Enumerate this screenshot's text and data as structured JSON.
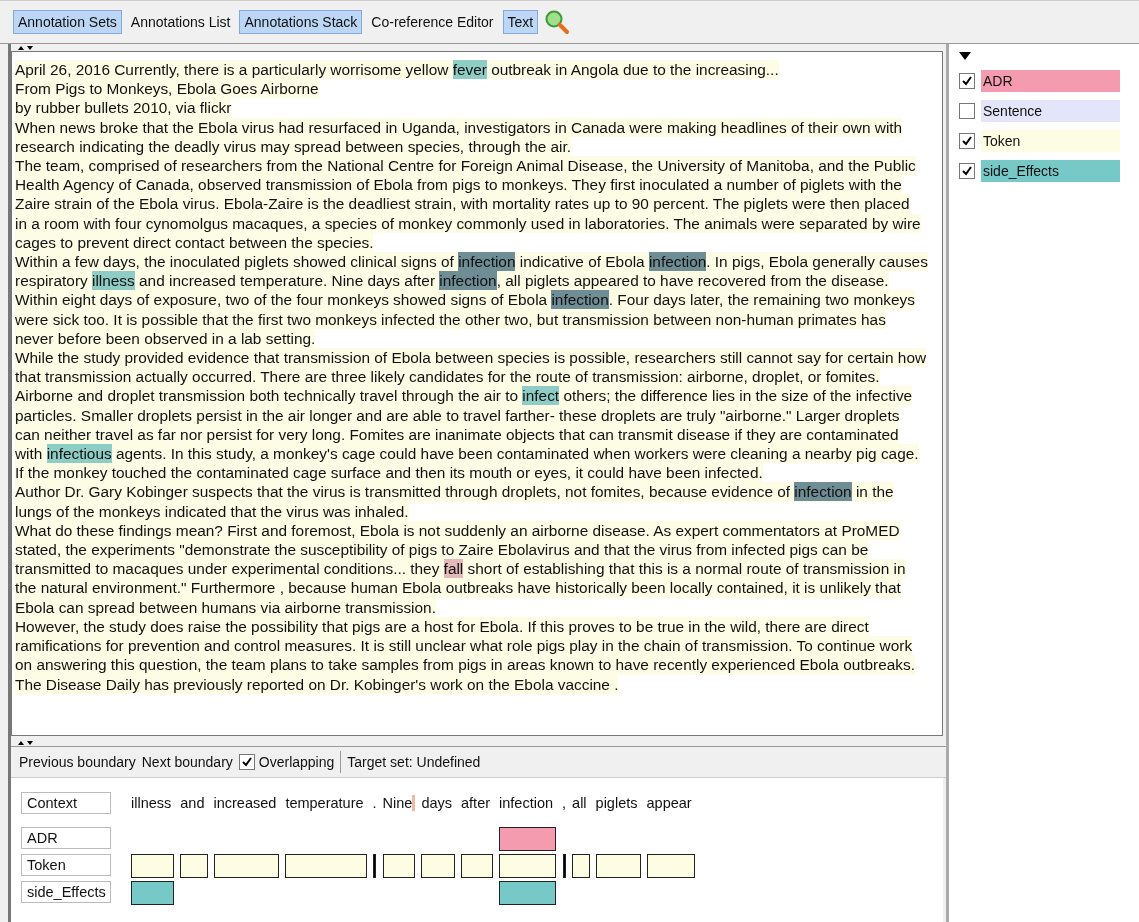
{
  "tabs": [
    {
      "label": "Annotation Sets",
      "selected": true
    },
    {
      "label": "Annotations List",
      "selected": false
    },
    {
      "label": "Annotations Stack",
      "selected": true
    },
    {
      "label": "Co-reference Editor",
      "selected": false
    },
    {
      "label": "Text",
      "selected": true
    }
  ],
  "document": {
    "lines": [
      [
        {
          "text": "April 26, 2016 Currently, there is a particularly worrisome yellow "
        },
        {
          "text": "fever",
          "color": "#8ecdc5"
        },
        {
          "text": " outbreak in Angola due to the increasing..."
        }
      ],
      [
        {
          "text": "From Pigs to Monkeys, Ebola Goes Airborne"
        }
      ],
      [
        {
          "text": "by rubber bullets 2010, via flickr"
        }
      ],
      [
        {
          "text": "When news broke that the Ebola virus had resurfaced in Uganda, investigators in Canada were making headlines of their own with"
        }
      ],
      [
        {
          "text": "research indicating the deadly virus may spread between species, through the air."
        }
      ],
      [
        {
          "text": "The team, comprised of researchers from the National Centre for Foreign Animal Disease, the University of Manitoba, and the Public"
        }
      ],
      [
        {
          "text": "Health Agency of Canada, observed transmission of Ebola from pigs to monkeys. They first inoculated a number of piglets with the"
        }
      ],
      [
        {
          "text": "Zaire strain of the Ebola virus. Ebola-Zaire is the deadliest strain, with mortality rates up to 90 percent. The piglets were then placed"
        }
      ],
      [
        {
          "text": "in a room with four cynomolgus macaques, a species of monkey commonly used in laboratories. The animals were separated by wire"
        }
      ],
      [
        {
          "text": "cages to prevent direct contact between the species."
        }
      ],
      [
        {
          "text": "Within a few days, the inoculated piglets showed clinical signs of "
        },
        {
          "text": "infection",
          "color": "#6f8d95"
        },
        {
          "text": " indicative of Ebola "
        },
        {
          "text": "infection",
          "color": "#6f8d95"
        },
        {
          "text": ". In pigs, Ebola generally causes"
        }
      ],
      [
        {
          "text": "respiratory "
        },
        {
          "text": "illness",
          "color": "#8ecdc5"
        },
        {
          "text": " and increased temperature. Nine days after "
        },
        {
          "text": "infection",
          "color": "#6f8d95"
        },
        {
          "text": ", all piglets appeared to have recovered from the disease."
        }
      ],
      [
        {
          "text": "Within eight days of exposure, two of the four monkeys showed signs of Ebola "
        },
        {
          "text": "infection",
          "color": "#6f8d95"
        },
        {
          "text": ". Four days later, the remaining two monkeys"
        }
      ],
      [
        {
          "text": "were sick too. It is possible that the first two monkeys infected the other two, but transmission between non-human primates has"
        }
      ],
      [
        {
          "text": "never before been observed in a lab setting."
        }
      ],
      [
        {
          "text": "While the study provided evidence that transmission of Ebola between species is possible, researchers still cannot say for certain how"
        }
      ],
      [
        {
          "text": "that transmission actually occurred. There are three likely candidates for the route of transmission: airborne, droplet, or fomites."
        }
      ],
      [
        {
          "text": "Airborne and droplet transmission both technically travel through the air to "
        },
        {
          "text": "infect",
          "color": "#8ecdc5"
        },
        {
          "text": " others; the difference lies in the size of the infective"
        }
      ],
      [
        {
          "text": "particles. Smaller droplets persist in the air longer and are able to travel farther- these droplets are truly \"airborne.\" Larger droplets"
        }
      ],
      [
        {
          "text": "can neither travel as far nor persist for very long. Fomites are inanimate objects that can transmit disease if they are contaminated"
        }
      ],
      [
        {
          "text": "with "
        },
        {
          "text": "infectious",
          "color": "#8ecdc5"
        },
        {
          "text": " agents. In this study, a monkey's cage could have been contaminated when workers were cleaning a nearby pig cage."
        }
      ],
      [
        {
          "text": "If the monkey touched the contaminated cage surface and then its mouth or eyes, it could have been infected."
        }
      ],
      [
        {
          "text": "Author Dr. Gary Kobinger suspects that the virus is transmitted through droplets, not fomites, because evidence of "
        },
        {
          "text": "infection",
          "color": "#6f8d95"
        },
        {
          "text": " in the"
        }
      ],
      [
        {
          "text": "lungs of the monkeys indicated that the virus was inhaled."
        }
      ],
      [
        {
          "text": "What do these findings mean? First and foremost, Ebola is not suddenly an airborne disease. As expert commentators at ProMED"
        }
      ],
      [
        {
          "text": "stated, the experiments \"demonstrate the susceptibility of pigs to Zaire Ebolavirus and that the virus from infected pigs can be"
        }
      ],
      [
        {
          "text": "transmitted to macaques under experimental conditions... they "
        },
        {
          "text": "fall",
          "color": "#e3b9b9"
        },
        {
          "text": " short of establishing that this is a normal route of transmission in"
        }
      ],
      [
        {
          "text": "the natural environment.\" Furthermore , because human Ebola outbreaks have historically been locally contained, it is unlikely that"
        }
      ],
      [
        {
          "text": "Ebola can spread between humans via airborne transmission."
        }
      ],
      [
        {
          "text": "However, the study does raise the possibility that pigs are a host for Ebola. If this proves to be true in the wild, there are direct"
        }
      ],
      [
        {
          "text": "ramifications for prevention and control measures. It is still unclear what role pigs play in the chain of transmission. To continue work"
        }
      ],
      [
        {
          "text": "on answering this question, the team plans to take samples from pigs in areas known to have recently experienced Ebola outbreaks."
        }
      ],
      [
        {
          "text": "The Disease Daily has previously reported on Dr. Kobinger's work on the Ebola vaccine ."
        }
      ]
    ]
  },
  "annotation_types": [
    {
      "name": "ADR",
      "checked": true,
      "color": "#f59bb0"
    },
    {
      "name": "Sentence",
      "checked": false,
      "color": "#e4e4fa"
    },
    {
      "name": "Token",
      "checked": true,
      "color": "#fdfde4"
    },
    {
      "name": "side_Effects",
      "checked": true,
      "color": "#77c9c7"
    }
  ],
  "stack_toolbar": {
    "buttons": [
      "Previous boundary",
      "Next boundary"
    ],
    "overlapping": {
      "label": "Overlapping",
      "checked": true
    },
    "target_set": "Target set: Undefined"
  },
  "stack": {
    "context_label": "Context",
    "tokens": [
      {
        "text": "illness",
        "cursor": false
      },
      {
        "text": "and",
        "cursor": false
      },
      {
        "text": "increased",
        "cursor": false
      },
      {
        "text": "temperature",
        "cursor": false
      },
      {
        "text": ".",
        "cursor": false
      },
      {
        "text": "Nine",
        "cursor": true
      },
      {
        "text": "days",
        "cursor": false
      },
      {
        "text": "after",
        "cursor": false
      },
      {
        "text": "infection",
        "cursor": false
      },
      {
        "text": ",",
        "cursor": false
      },
      {
        "text": "all",
        "cursor": false
      },
      {
        "text": "piglets",
        "cursor": false
      },
      {
        "text": "appear",
        "cursor": false
      }
    ],
    "rows": [
      {
        "label": "ADR",
        "color": "#f59bb0",
        "covers": [
          false,
          false,
          false,
          false,
          false,
          false,
          false,
          false,
          true,
          false,
          false,
          false,
          false
        ]
      },
      {
        "label": "Token",
        "color": "#fdfde4",
        "covers": [
          true,
          true,
          true,
          true,
          true,
          true,
          true,
          true,
          true,
          true,
          true,
          true,
          true
        ]
      },
      {
        "label": "side_Effects",
        "color": "#77c9c7",
        "covers": [
          true,
          false,
          false,
          false,
          false,
          false,
          false,
          false,
          true,
          false,
          false,
          false,
          false
        ]
      }
    ]
  }
}
